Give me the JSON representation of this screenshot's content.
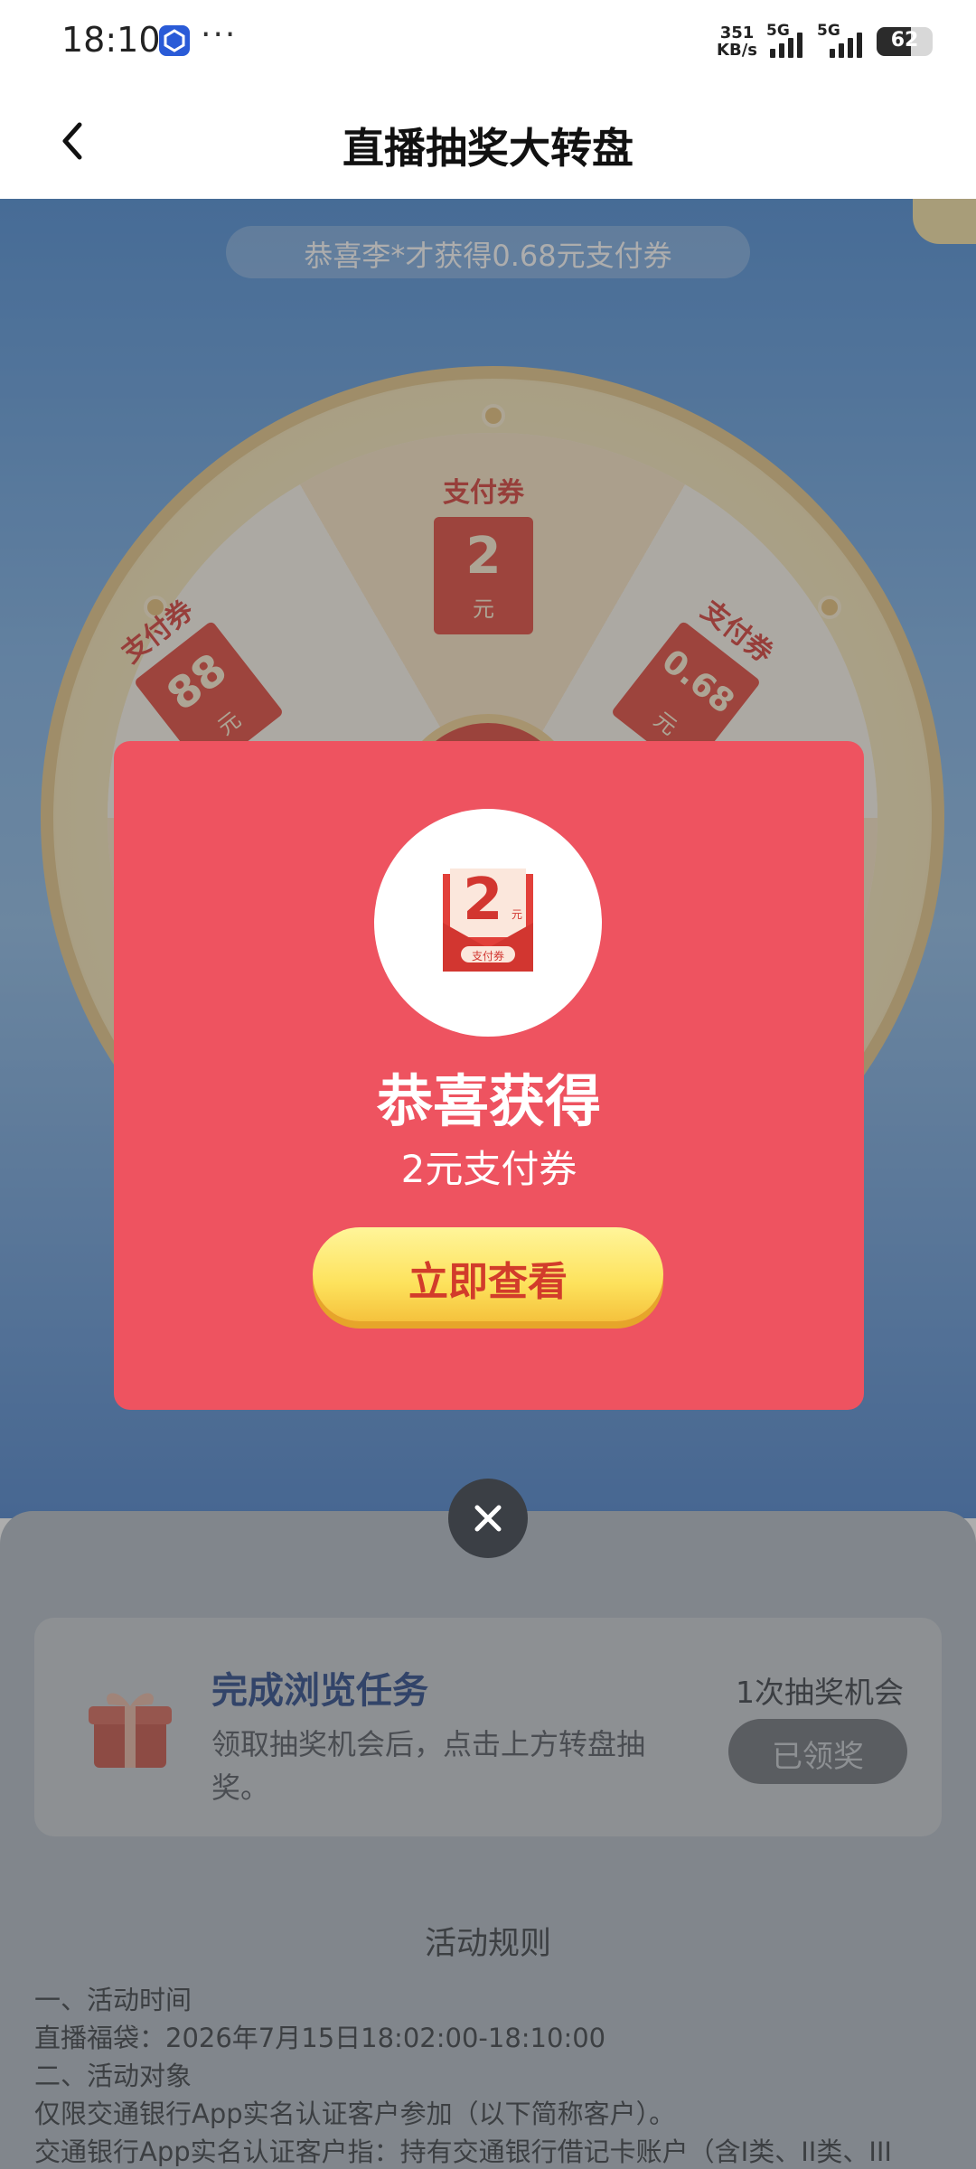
{
  "status_bar": {
    "time": "18:10",
    "dots": "···",
    "net_speed_value": "351",
    "net_speed_unit": "KB/s",
    "signal1_label": "5G",
    "signal2_label": "5G",
    "battery": "62",
    "battery_level": 0.62
  },
  "nav": {
    "title": "直播抽奖大转盘",
    "back_icon": "chevron-left-icon"
  },
  "scene": {
    "winner_text": "恭喜李*才获得0.68元支付券",
    "prizes": [
      {
        "label": "支付券",
        "amount": "88",
        "unit": "元"
      },
      {
        "label": "支付券",
        "amount": "2",
        "unit": "元"
      },
      {
        "label": "支付券",
        "amount": "0.68",
        "unit": "元"
      }
    ]
  },
  "modal": {
    "coupon_amount": "2",
    "coupon_unit": "元",
    "coupon_tag": "支付券",
    "title": "恭喜获得",
    "subtitle": "2元支付券",
    "button_label": "立即查看",
    "close_icon": "close-icon",
    "accent_color": "#ee5360"
  },
  "task": {
    "title": "完成浏览任务",
    "desc": "领取抽奖机会后，点击上方转盘抽奖。",
    "chance": "1次抽奖机会",
    "button_label": "已领奖",
    "icon": "gift-icon"
  },
  "rules": {
    "title": "活动规则",
    "lines": [
      "一、活动时间",
      "直播福袋：2026年7月15日18:02:00-18:10:00",
      "二、活动对象",
      "仅限交通银行App实名认证客户参加（以下简称客户）。",
      "交通银行App实名认证客户指：持有交通银行借记卡账户（含I类、II类、III"
    ]
  }
}
